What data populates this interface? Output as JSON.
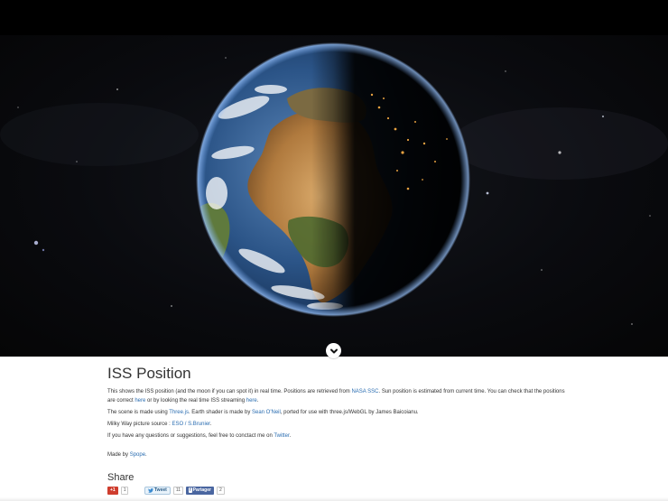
{
  "page": {
    "title": "ISS Position",
    "intro": {
      "t1": "This shows the ISS position (and the moon if you can spot it) in real time. Positions are retrieved from ",
      "link_nasa": "NASA SSC",
      "t2": ". Sun position is estimated from current time. You can check that the positions are correct ",
      "link_here1": "here",
      "t3": " or by looking the real time ISS streaming ",
      "link_here2": "here",
      "t4": "."
    },
    "scene": {
      "t1": "The scene is made using ",
      "link_three": "Three.js",
      "t2": ". Earth shader is made by ",
      "link_sean": "Sean O'Neil",
      "t3": ", ported for use with three.js/WebGL by James Baicoianu."
    },
    "milkyway": {
      "t1": "Milky Way picture source : ",
      "link_eso": "ESO / S.Brunier",
      "t2": "."
    },
    "contact": {
      "t1": "If you have any questions or suggestions, feel free to conctact me on ",
      "link_twitter": "Twitter",
      "t2": "."
    },
    "made_by": {
      "t1": "Made by ",
      "link_author": "Spope",
      "t2": "."
    }
  },
  "share": {
    "heading": "Share",
    "gplus_label": "+1",
    "gplus_count": "1",
    "tweet_label": "Tweet",
    "tweet_count": "11",
    "facebook_label": "Partager",
    "facebook_count": "2"
  },
  "icons": {
    "scroll": "chevron-down-icon",
    "twitter": "twitter-bird-icon",
    "facebook": "facebook-f-icon"
  },
  "colors": {
    "link": "#2a6db1",
    "gplus": "#cf3d2e",
    "facebook": "#4a66a0",
    "night_side": "#0b0c10"
  }
}
